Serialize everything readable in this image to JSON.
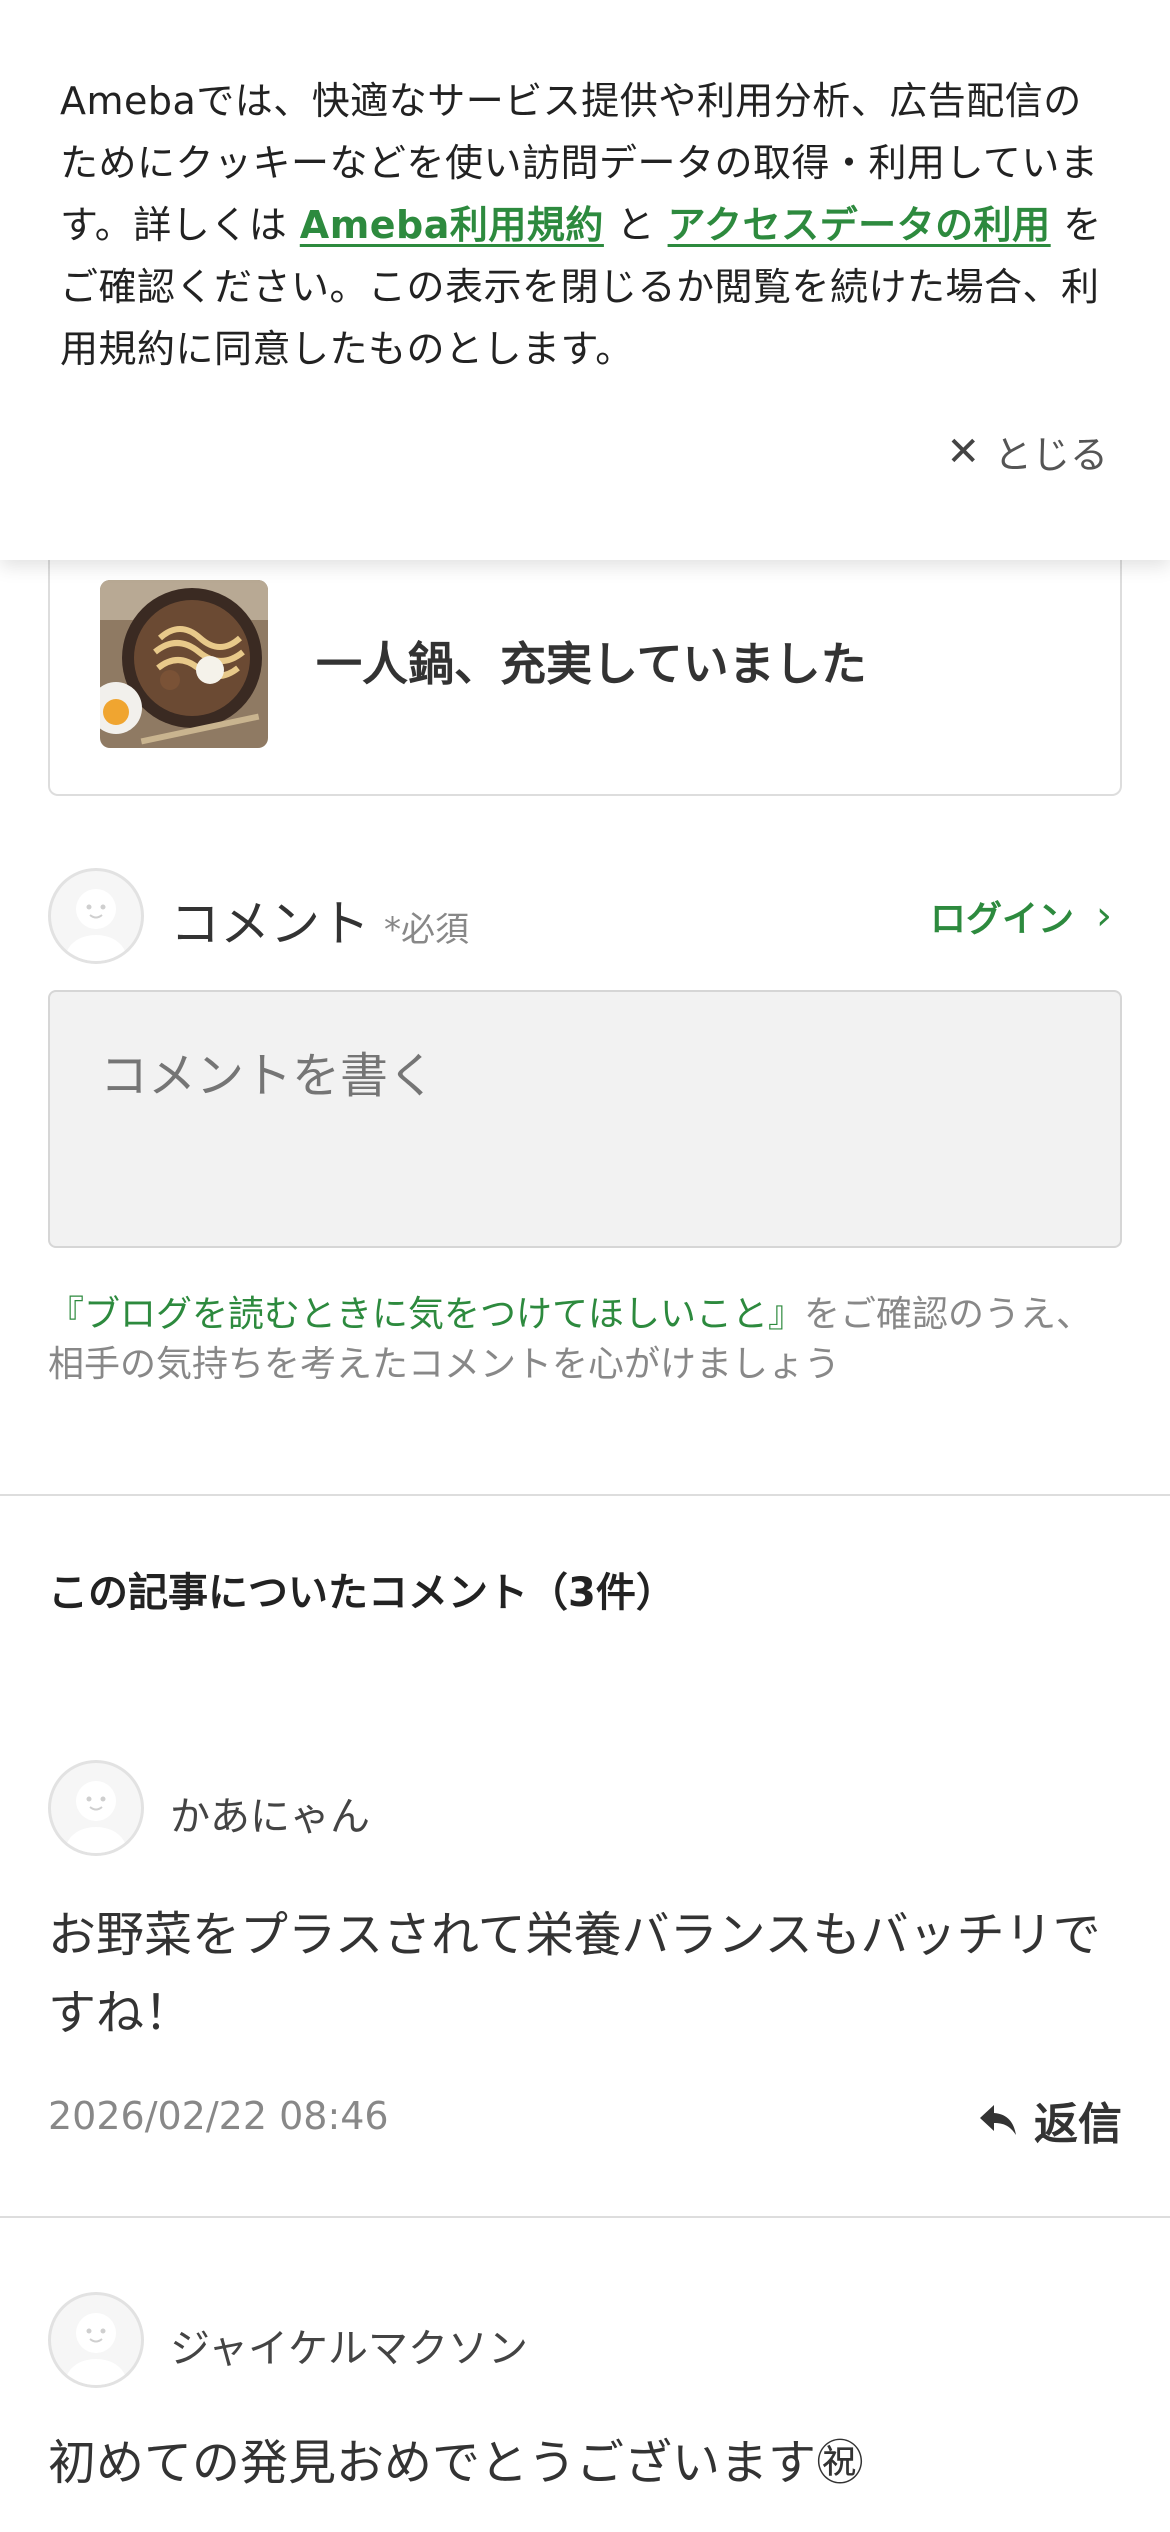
{
  "cookie_banner": {
    "text_1": "Amebaでは、快適なサービス提供や利用分析、広告配信のためにクッキーなどを使い訪問データの取得・利用しています。詳しくは ",
    "terms_link": "Ameba利用規約",
    "text_2": " と ",
    "access_link": "アクセスデータの利用",
    "text_3": " をご確認ください。この表示を閉じるか閲覧を続けた場合、利用規約に同意したものとします。",
    "close_label": "とじる"
  },
  "article": {
    "title": "一人鍋、充実していました"
  },
  "comment_form": {
    "label": "コメント",
    "required": "*必須",
    "login": "ログイン",
    "placeholder": "コメントを書く",
    "guide_link": "『ブログを読むときに気をつけてほしいこと』",
    "notice_text": "をご確認のうえ、相手の気持ちを考えたコメントを心がけましょう"
  },
  "comments": {
    "heading": "この記事についたコメント（3件）",
    "items": [
      {
        "name": "かあにゃん",
        "body": "お野菜をプラスされて栄養バランスもバッチリですね！",
        "date": "2026/02/22 08:46",
        "reply": "返信"
      },
      {
        "name": "ジャイケルマクソン",
        "body": "初めての発見おめでとうございます㊗"
      }
    ]
  },
  "colors": {
    "accent_green": "#2d8a3e",
    "text": "#333333",
    "muted": "#888888"
  }
}
